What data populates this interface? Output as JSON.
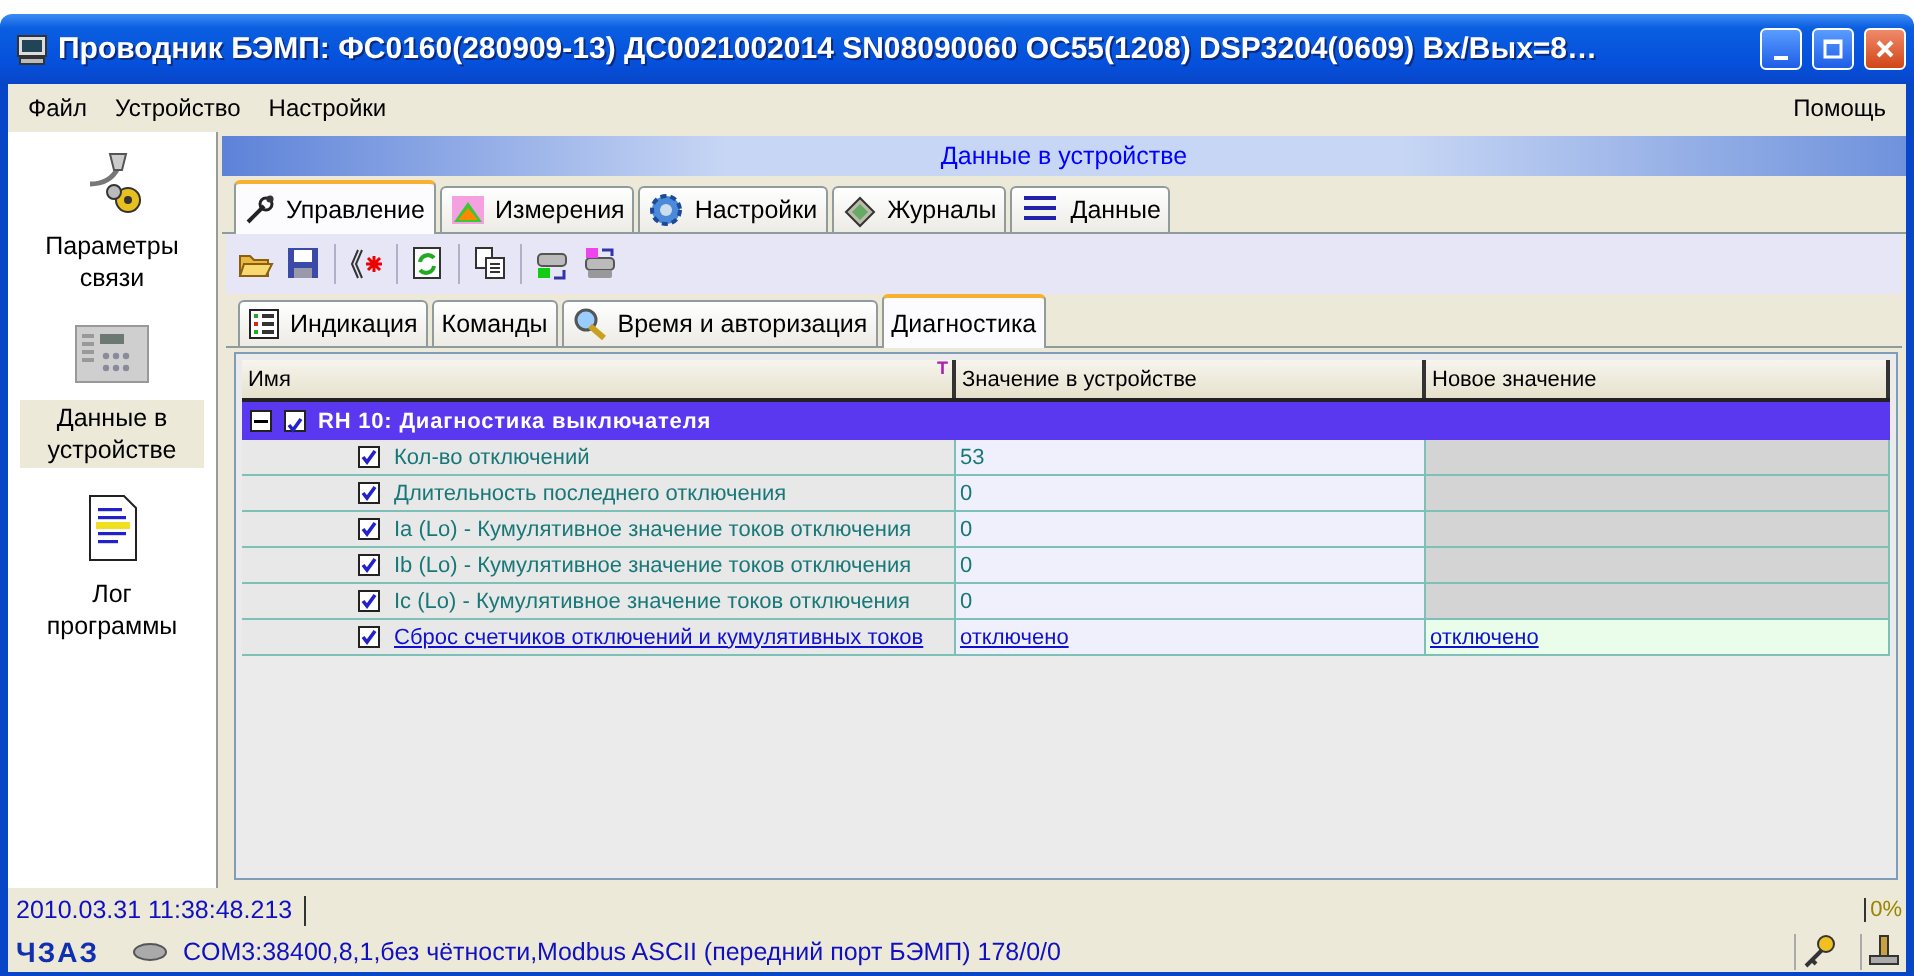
{
  "window": {
    "title": "Проводник БЭМП: ФС0160(280909-13) ДС0021002014 SN08090060 ОС55(1208) DSP3204(0609) Вх/Вых=8…"
  },
  "menu": {
    "items": [
      "Файл",
      "Устройство",
      "Настройки"
    ],
    "help": "Помощь"
  },
  "sidebar": {
    "items": [
      {
        "label": "Параметры связи",
        "kind": "connection",
        "selected": false
      },
      {
        "label": "Данные в устройстве",
        "kind": "device",
        "selected": true
      },
      {
        "label": "Лог программы",
        "kind": "log",
        "selected": false
      }
    ]
  },
  "panel_title": "Данные в устройстве",
  "tabs": [
    {
      "label": "Управление",
      "kind": "control",
      "selected": true
    },
    {
      "label": "Измерения",
      "kind": "measure",
      "selected": false
    },
    {
      "label": "Настройки",
      "kind": "settings",
      "selected": false
    },
    {
      "label": "Журналы",
      "kind": "journal",
      "selected": false
    },
    {
      "label": "Данные",
      "kind": "binary",
      "selected": false
    }
  ],
  "subtabs": [
    {
      "label": "Индикация",
      "kind": "indication",
      "selected": false
    },
    {
      "label": "Команды",
      "kind": "plain",
      "selected": false
    },
    {
      "label": "Время и авторизация",
      "kind": "key",
      "selected": false
    },
    {
      "label": "Диагностика",
      "kind": "plain",
      "selected": true
    }
  ],
  "table": {
    "columns": [
      "Имя",
      "Значение в устройстве",
      "Новое значение"
    ],
    "filter_mark": "T",
    "group": {
      "label": "RH 10: Диагностика выключателя",
      "expanded": true,
      "checked": true
    },
    "rows": [
      {
        "kind": "readonly",
        "checked": true,
        "name": "Кол-во отключений",
        "value": "53"
      },
      {
        "kind": "readonly",
        "checked": true,
        "name": "Длительность последнего отключения",
        "value": "0"
      },
      {
        "kind": "readonly",
        "checked": true,
        "name": "Ia (Lo) - Кумулятивное значение токов отключения",
        "value": "0"
      },
      {
        "kind": "readonly",
        "checked": true,
        "name": "Ib (Lo) - Кумулятивное значение токов отключения",
        "value": "0"
      },
      {
        "kind": "readonly",
        "checked": true,
        "name": "Ic (Lo) - Кумулятивное значение токов отключения",
        "value": "0"
      },
      {
        "kind": "link",
        "checked": true,
        "name": "Сброс счетчиков отключений и кумулятивных токов",
        "value": "отключено",
        "new_value": "отключено"
      }
    ]
  },
  "status_bar": {
    "timestamp": "2010.03.31 11:38:48.213",
    "progress": {
      "level": 0,
      "reading": "0%"
    }
  },
  "footer": {
    "logo": "ЧЗАЗ",
    "connection": "COM3:38400,8,1,без чётности,Modbus ASCII (передний порт БЭМП) 178/0/0"
  }
}
